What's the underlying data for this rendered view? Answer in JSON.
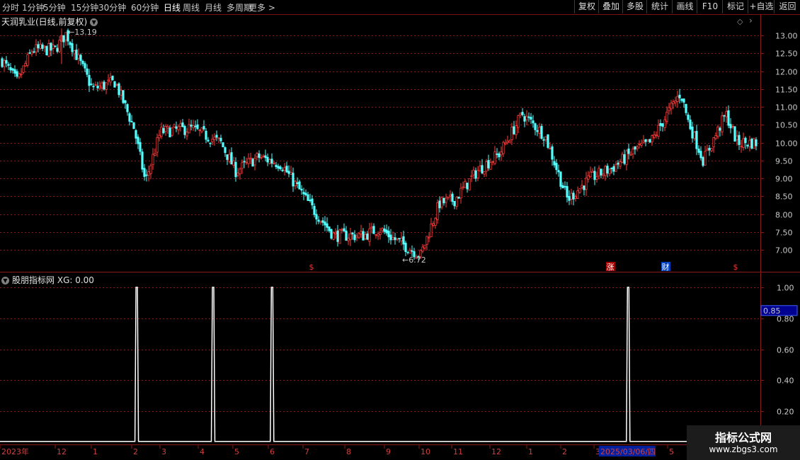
{
  "toolbar": {
    "left": [
      {
        "label": "分时",
        "active": false
      },
      {
        "label": "1分钟",
        "active": false
      },
      {
        "label": "5分钟",
        "active": false
      },
      {
        "label": "15分钟",
        "active": false
      },
      {
        "label": "30分钟",
        "active": false
      },
      {
        "label": "60分钟",
        "active": false
      },
      {
        "label": "日线",
        "active": true
      },
      {
        "label": "周线",
        "active": false
      },
      {
        "label": "月线",
        "active": false
      },
      {
        "label": "多周期",
        "active": false
      },
      {
        "label": "更多 >",
        "active": false
      }
    ],
    "right": [
      "复权",
      "叠加",
      "多股",
      "统计",
      "画线",
      "F10",
      "标记",
      "+自选",
      "返回"
    ]
  },
  "main_chart": {
    "title": "天润乳业(日线,前复权)",
    "y_ticks": [
      "13.00",
      "12.50",
      "12.00",
      "11.50",
      "11.00",
      "10.50",
      "10.00",
      "9.50",
      "9.00",
      "8.50",
      "8.00",
      "7.50",
      "7.00"
    ],
    "high_label": "13.19",
    "low_label": "6.72",
    "markers": [
      {
        "text": "$",
        "color": "#ff3030"
      },
      {
        "text": "涨",
        "color": "#ffffff",
        "bg": "#a00000"
      },
      {
        "text": "财",
        "color": "#ffffff",
        "bg": "#0040c0"
      },
      {
        "text": "$",
        "color": "#ff3030"
      }
    ]
  },
  "indicator": {
    "title": "股朋指标网",
    "value_label": "XG: 0.00",
    "y_ticks": [
      "1.00",
      "0.80",
      "0.60",
      "0.40",
      "0.20"
    ],
    "current_value": "0.85"
  },
  "x_axis": [
    "2023年",
    "12",
    "1",
    "2",
    "3",
    "4",
    "5",
    "6",
    "7",
    "8",
    "9",
    "10",
    "11",
    "12",
    "1",
    "2",
    "3",
    "2025/03/06/四",
    "5"
  ],
  "watermark": {
    "line1": "指标公式网",
    "line2": "www.zbgs3.com"
  },
  "colors": {
    "up": "#ff3c3c",
    "down": "#54ffff",
    "grid": "#8b1a1a",
    "signal": "#ffffff"
  },
  "chart_data": {
    "type": "candlestick",
    "title": "天润乳业(日线,前复权)",
    "ylim": [
      6.7,
      13.4
    ],
    "price_path": [
      {
        "t": 0,
        "p": 12.3
      },
      {
        "t": 0.02,
        "p": 11.7
      },
      {
        "t": 0.04,
        "p": 12.6
      },
      {
        "t": 0.07,
        "p": 12.6
      },
      {
        "t": 0.085,
        "p": 13.05
      },
      {
        "t": 0.12,
        "p": 11.5
      },
      {
        "t": 0.15,
        "p": 11.7
      },
      {
        "t": 0.175,
        "p": 10.4
      },
      {
        "t": 0.19,
        "p": 8.9
      },
      {
        "t": 0.21,
        "p": 10.3
      },
      {
        "t": 0.25,
        "p": 10.4
      },
      {
        "t": 0.29,
        "p": 10.0
      },
      {
        "t": 0.31,
        "p": 9.2
      },
      {
        "t": 0.34,
        "p": 9.6
      },
      {
        "t": 0.37,
        "p": 9.4
      },
      {
        "t": 0.41,
        "p": 8.2
      },
      {
        "t": 0.44,
        "p": 7.4
      },
      {
        "t": 0.48,
        "p": 7.4
      },
      {
        "t": 0.5,
        "p": 7.6
      },
      {
        "t": 0.52,
        "p": 7.3
      },
      {
        "t": 0.555,
        "p": 6.85
      },
      {
        "t": 0.58,
        "p": 8.3
      },
      {
        "t": 0.6,
        "p": 8.4
      },
      {
        "t": 0.63,
        "p": 9.2
      },
      {
        "t": 0.66,
        "p": 9.7
      },
      {
        "t": 0.69,
        "p": 10.8
      },
      {
        "t": 0.72,
        "p": 10.2
      },
      {
        "t": 0.75,
        "p": 8.4
      },
      {
        "t": 0.78,
        "p": 9.0
      },
      {
        "t": 0.81,
        "p": 9.3
      },
      {
        "t": 0.84,
        "p": 9.8
      },
      {
        "t": 0.86,
        "p": 10.0
      },
      {
        "t": 0.885,
        "p": 10.9
      },
      {
        "t": 0.9,
        "p": 11.4
      },
      {
        "t": 0.91,
        "p": 10.6
      },
      {
        "t": 0.93,
        "p": 9.5
      },
      {
        "t": 0.96,
        "p": 10.8
      },
      {
        "t": 0.975,
        "p": 10.0
      },
      {
        "t": 1.0,
        "p": 10.0
      }
    ],
    "signals": [
      0.178,
      0.279,
      0.357,
      0.828
    ],
    "indicator_ylim": [
      0,
      1.0
    ]
  }
}
